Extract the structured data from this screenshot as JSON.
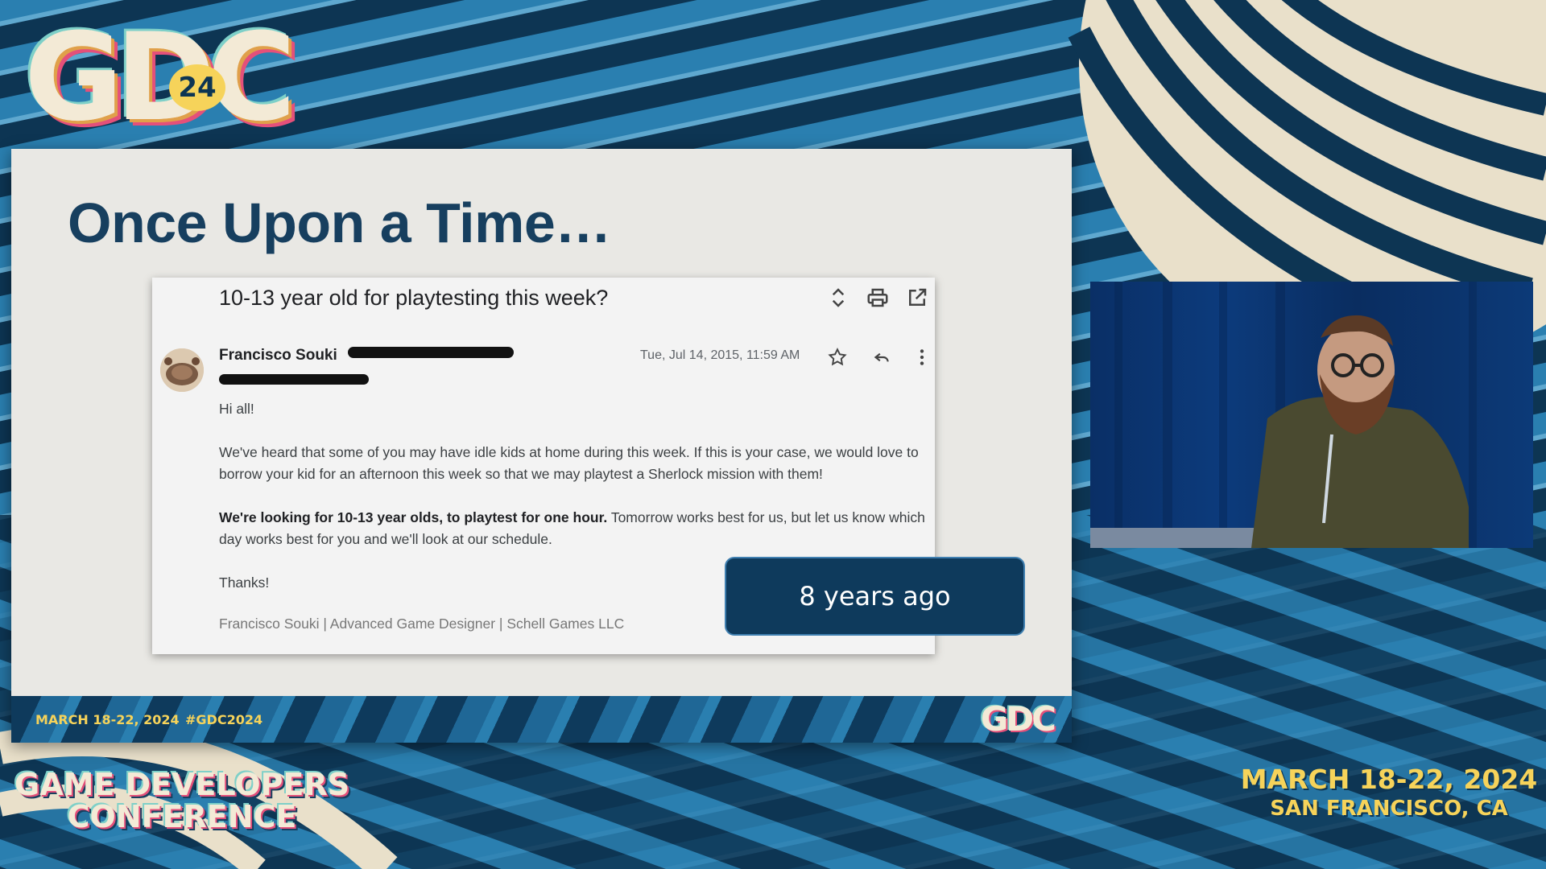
{
  "brand": {
    "logo_letters": "GDC",
    "logo_badge": "24",
    "conference_title_line1": "GAME DEVELOPERS",
    "conference_title_line2": "CONFERENCE",
    "event_dates": "MARCH 18-22, 2024",
    "event_location": "SAN FRANCISCO, CA"
  },
  "slide": {
    "title": "Once Upon a Time…",
    "footer_dates": "MARCH 18-22, 2024",
    "footer_hashtag": "#GDC2024",
    "footer_logo": "GDC",
    "badge_text": "8 years ago"
  },
  "email": {
    "subject": "10-13 year old for playtesting this week?",
    "sender_name": "Francisco Souki",
    "date": "Tue, Jul 14, 2015, 11:59 AM",
    "greeting": "Hi all!",
    "paragraph1": "We've heard that some of you may have idle kids at home during this week. If this is your case, we would love to borrow your kid for an afternoon this week so that we may playtest a Sherlock mission with them!",
    "paragraph2_bold": "We're looking for 10-13 year olds, to playtest for one hour.",
    "paragraph2_rest": " Tomorrow works best for us, but let us know which day works best for you and we'll look at our schedule.",
    "closing": "Thanks!",
    "signature": "Francisco Souki | Advanced Game Designer | Schell Games LLC",
    "icons": [
      "expand-collapse-icon",
      "print-icon",
      "open-in-new-window-icon",
      "star-icon",
      "reply-icon",
      "more-options-icon"
    ]
  },
  "colors": {
    "navy": "#0e3a5c",
    "title_blue": "#173f5f",
    "accent_yellow": "#f6d35a",
    "cream": "#f3ead6"
  }
}
